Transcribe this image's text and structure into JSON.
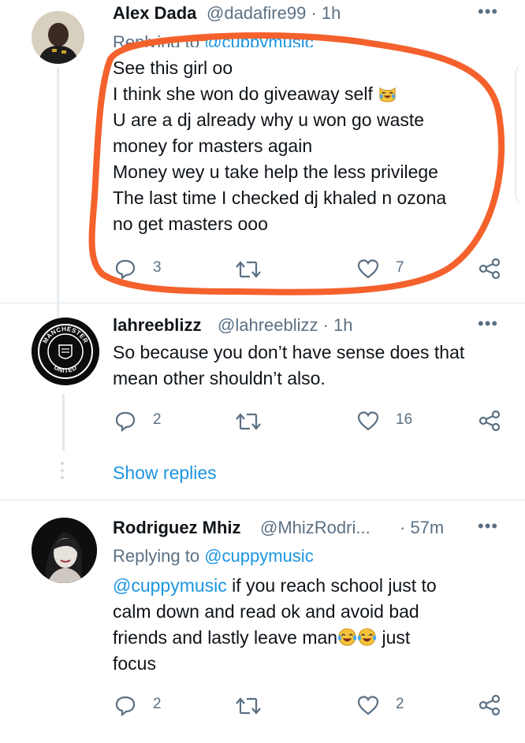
{
  "tweet1": {
    "name": "Alex Dada",
    "handle": "@dadafire99 · 1h",
    "replying_prefix": "Replying to",
    "replying_handle": "@cuppymusic",
    "lines": [
      "See this girl oo",
      "I think she won do giveaway self",
      "U are a dj already why u won go waste",
      "money for masters again",
      "Money wey u take help the less privilege",
      "The last time I checked dj khaled n ozona",
      "no get masters ooo"
    ],
    "emoji_name": "laughing-cat-emoji",
    "reply_count": "3",
    "like_count": "7",
    "annotation_color": "#f4612c"
  },
  "tweet2": {
    "name": "lahreeblizz",
    "handle": "@lahreeblizz · 1h",
    "lines": [
      "So because you don’t have sense does that",
      "mean other shouldn’t also."
    ],
    "avatar_text_top": "MANCHESTER",
    "avatar_text_bottom": "UNITED",
    "reply_count": "2",
    "like_count": "16"
  },
  "show_replies": "Show replies",
  "tweet3": {
    "name": "Rodriguez Mhiz",
    "handle": "@MhizRodri...",
    "time": "· 57m",
    "replying_prefix": "Replying to",
    "replying_handle": "@cuppymusic",
    "mention": "@cuppymusic",
    "line1_rest": " if you reach school just to",
    "line2": "calm down and read ok and avoid bad",
    "line3_start": "friends and lastly leave man",
    "line3_end": " just",
    "line4": "focus",
    "emoji_name": "face-with-tears-of-joy-emoji",
    "reply_count": "2",
    "like_count": "2"
  },
  "colors": {
    "link": "#1b95e0",
    "secondary_text": "#5b7083"
  }
}
